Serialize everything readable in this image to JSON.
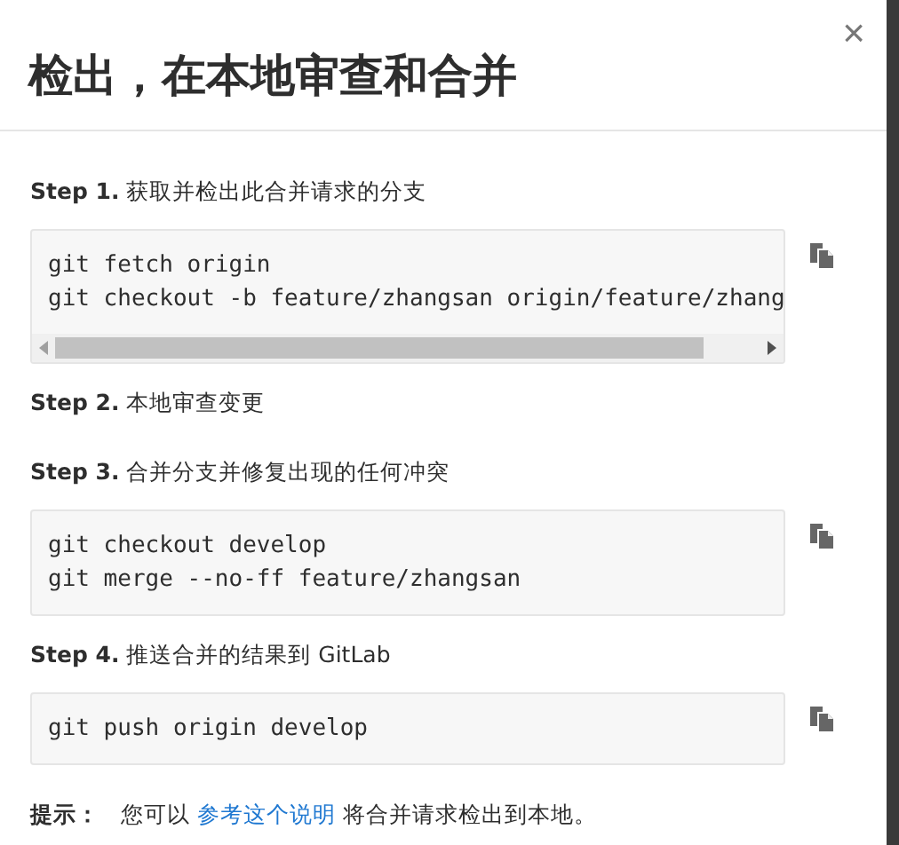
{
  "dialog": {
    "title": "检出，在本地审查和合并",
    "close": "×"
  },
  "steps": [
    {
      "label": "**Step 1.** 获取并检出此合并请求的分支",
      "code": [
        "git fetch origin",
        "git checkout -b feature/zhangsan origin/feature/zhang"
      ],
      "scrollable": true
    },
    {
      "label": "**Step 2.** 本地审查变更"
    },
    {
      "label": "**Step 3.** 合并分支并修复出现的任何冲突",
      "code": [
        "git checkout develop",
        "git merge --no-ff feature/zhangsan"
      ],
      "scrollable": false
    },
    {
      "label": "**Step 4.** 推送合并的结果到 GitLab",
      "code": [
        "git push origin develop"
      ],
      "scrollable": false
    }
  ],
  "hint": {
    "label": "提示：",
    "before": "您可以 ",
    "link": "参考这个说明",
    "after": " 将合并请求检出到本地。"
  }
}
